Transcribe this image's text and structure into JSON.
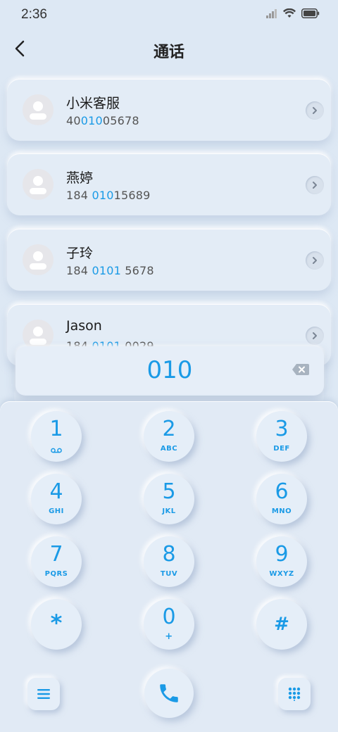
{
  "status": {
    "time": "2:36"
  },
  "header": {
    "title": "通话"
  },
  "contacts": [
    {
      "name": "小米客服",
      "num_pre": "40",
      "num_hl": "010",
      "num_post": "05678"
    },
    {
      "name": "燕婷",
      "num_pre": "184 ",
      "num_hl": "010",
      "num_post": "15689"
    },
    {
      "name": "子玲",
      "num_pre": "184 ",
      "num_hl": "0101",
      "num_post": " 5678"
    },
    {
      "name": "Jason",
      "num_pre": "184 ",
      "num_hl": "0101",
      "num_post": " 0029"
    }
  ],
  "dial": {
    "value": "010"
  },
  "keys": [
    {
      "digit": "1",
      "letters": ""
    },
    {
      "digit": "2",
      "letters": "ABC"
    },
    {
      "digit": "3",
      "letters": "DEF"
    },
    {
      "digit": "4",
      "letters": "GHI"
    },
    {
      "digit": "5",
      "letters": "JKL"
    },
    {
      "digit": "6",
      "letters": "MNO"
    },
    {
      "digit": "7",
      "letters": "PQRS"
    },
    {
      "digit": "8",
      "letters": "TUV"
    },
    {
      "digit": "9",
      "letters": "WXYZ"
    },
    {
      "digit": "*",
      "letters": ""
    },
    {
      "digit": "0",
      "letters": "+"
    },
    {
      "digit": "#",
      "letters": ""
    }
  ],
  "colors": {
    "accent": "#1a9ae6",
    "background": "#dde8f4"
  },
  "icons": {
    "back": "back-arrow-icon",
    "backspace": "backspace-icon",
    "menu": "menu-icon",
    "call": "phone-icon",
    "keypad": "keypad-icon",
    "voicemail": "voicemail-icon"
  }
}
